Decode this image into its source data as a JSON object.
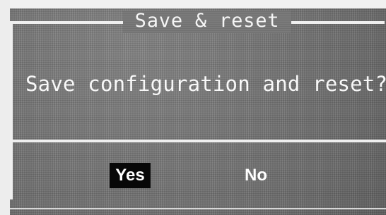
{
  "dialog": {
    "title": "Save & reset",
    "message": "Save configuration and reset?",
    "buttons": {
      "yes": "Yes",
      "no": "No"
    }
  },
  "colors": {
    "screen_gray": "#777777",
    "frame_light": "#efefef",
    "selected_button": "#080808",
    "text": "#f8f8f8"
  }
}
